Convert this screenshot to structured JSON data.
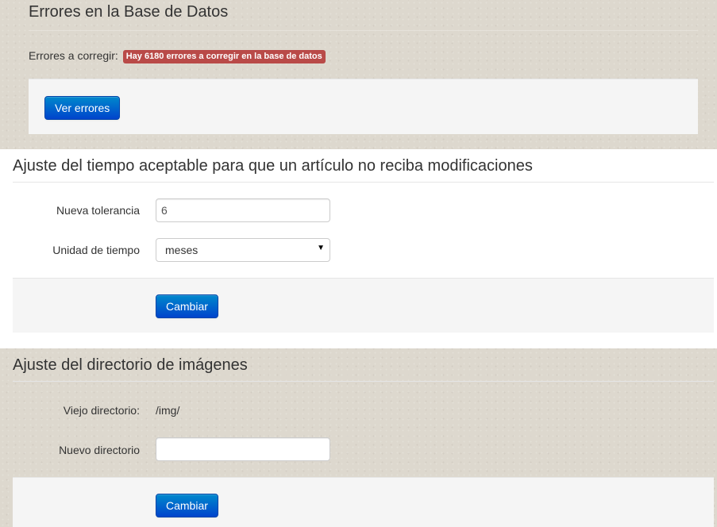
{
  "errors_section": {
    "title": "Errores en la Base de Datos",
    "label": "Errores a corregir:",
    "badge": "Hay 6180 errores a corregir en la base de datos",
    "button": "Ver errores"
  },
  "tolerance_section": {
    "title": "Ajuste del tiempo aceptable para que un artículo no reciba modificaciones",
    "tolerance_label": "Nueva tolerancia",
    "tolerance_value": "6",
    "unit_label": "Unidad de tiempo",
    "unit_value": "meses",
    "button": "Cambiar"
  },
  "images_section": {
    "title": "Ajuste del directorio de imágenes",
    "old_dir_label": "Viejo directorio:",
    "old_dir_value": "/img/",
    "new_dir_label": "Nuevo directorio",
    "new_dir_value": "",
    "button": "Cambiar"
  },
  "icons": {
    "select_caret": "caret-down-icon"
  },
  "colors": {
    "primary_button": "#0055cc",
    "danger_badge": "#b94a48",
    "page_background": "#ddd8ce"
  }
}
